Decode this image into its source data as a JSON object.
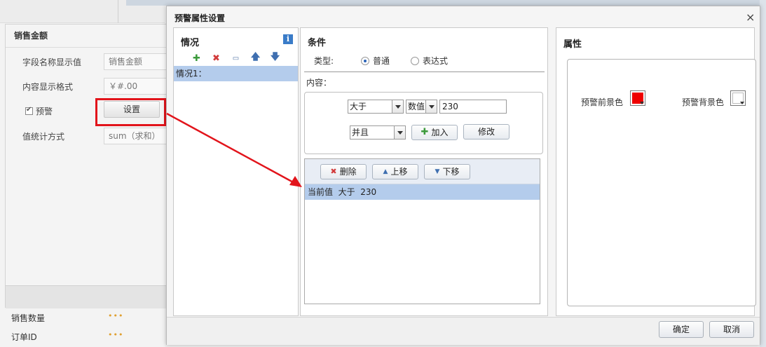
{
  "side_panel": {
    "title": "销售金额",
    "rows": [
      {
        "label": "字段名称显示值",
        "value": "销售金额"
      },
      {
        "label": "内容显示格式",
        "value": "￥#.00"
      }
    ],
    "alert_checkbox_label": "预警",
    "alert_checked": true,
    "settings_button": "设置",
    "agg_label": "值统计方式",
    "agg_value": "sum（求和）"
  },
  "field_list": [
    {
      "label": "销售数量",
      "dots": "•••"
    },
    {
      "label": "订单ID",
      "dots": "•••"
    }
  ],
  "dialog": {
    "title": "预警属性设置",
    "close_glyph": "×",
    "cases": {
      "title": "情况",
      "info_glyph": "i",
      "items": [
        "情况1："
      ]
    },
    "conditions": {
      "title": "条件",
      "type_label": "类型:",
      "type_options": [
        "普通",
        "表达式"
      ],
      "type_selected": "普通",
      "content_label": "内容：",
      "operator": "大于",
      "value_type": "数值",
      "value": "230",
      "logic": "并且",
      "add_button": "加入",
      "modify_button": "修改",
      "delete_button": "删除",
      "move_up_button": "上移",
      "move_down_button": "下移",
      "list_items": [
        "当前值  大于  230"
      ]
    },
    "properties": {
      "title": "属性",
      "fg_label": "预警前景色",
      "fg_color": "#ee0000",
      "bg_label": "预警背景色",
      "bg_color": "#ffffff"
    },
    "ok_button": "确定",
    "cancel_button": "取消"
  },
  "accent_color": "#e2141b"
}
